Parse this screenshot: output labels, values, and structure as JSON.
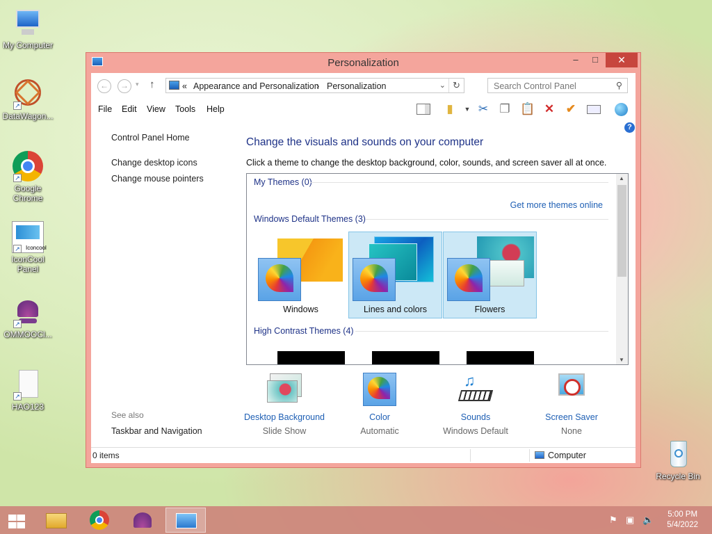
{
  "desktop": {
    "icons": [
      {
        "label": "My Computer"
      },
      {
        "label": "DataWagon..."
      },
      {
        "label": "Google Chrome"
      },
      {
        "label": "IconCool Panel"
      },
      {
        "label": "OMMOOCl..."
      },
      {
        "label": "HAO123"
      },
      {
        "label": "Recycle Bin"
      }
    ]
  },
  "window": {
    "title": "Personalization",
    "buttons": {
      "minimize": "–",
      "maximize": "□",
      "close": "✕"
    },
    "address": {
      "crumbs": [
        "«",
        "Appearance and Personalization",
        "›",
        "Personalization"
      ]
    },
    "search": {
      "placeholder": "Search Control Panel"
    },
    "menu": [
      "File",
      "Edit",
      "View",
      "Tools",
      "Help"
    ],
    "left": {
      "home": "Control Panel Home",
      "links": [
        "Change desktop icons",
        "Change mouse pointers"
      ],
      "see_also": "See also",
      "see_also_links": [
        "Taskbar and Navigation"
      ]
    },
    "main": {
      "heading": "Change the visuals and sounds on your computer",
      "subtext": "Click a theme to change the desktop background, color, sounds, and screen saver all at once.",
      "my_themes": "My Themes (0)",
      "get_more": "Get more themes online",
      "default_themes": "Windows Default Themes (3)",
      "themes": [
        {
          "name": "Windows",
          "selected": false
        },
        {
          "name": "Lines and colors",
          "selected": true
        },
        {
          "name": "Flowers",
          "selected": true
        }
      ],
      "high_contrast": "High Contrast Themes (4)",
      "bottom": [
        {
          "label": "Desktop Background",
          "value": "Slide Show"
        },
        {
          "label": "Color",
          "value": "Automatic"
        },
        {
          "label": "Sounds",
          "value": "Windows Default"
        },
        {
          "label": "Screen Saver",
          "value": "None"
        }
      ]
    },
    "status": {
      "items": "0 items",
      "location": "Computer"
    }
  },
  "taskbar": {
    "time": "5:00 PM",
    "date": "5/4/2022"
  },
  "colors": {
    "accent": "#f4a59c",
    "link": "#1e3287",
    "selection": "#cce8f6"
  }
}
